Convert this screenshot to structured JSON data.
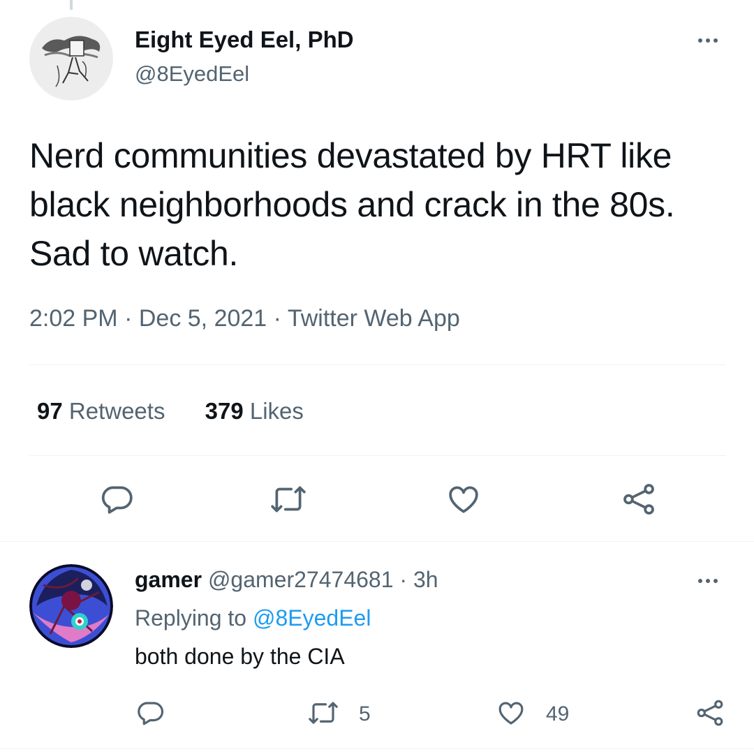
{
  "tweet": {
    "author_name": "Eight Eyed Eel, PhD",
    "author_handle": "@8EyedEel",
    "text": "Nerd communities devastated by HRT like black neighborhoods and crack in the 80s. Sad to watch.",
    "time": "2:02 PM",
    "date": "Dec 5, 2021",
    "source": "Twitter Web App",
    "separator": "·",
    "retweets_count": "97",
    "retweets_label": "Retweets",
    "likes_count": "379",
    "likes_label": "Likes"
  },
  "reply": {
    "author_name": "gamer",
    "author_handle": "@gamer27474681",
    "separator": "·",
    "age": "3h",
    "replying_label": "Replying to",
    "replying_handle": "@8EyedEel",
    "text": "both done by the CIA",
    "retweet_count": "5",
    "like_count": "49"
  },
  "icons": {
    "reply": "speech-bubble-icon",
    "retweet": "retweet-arrows-icon",
    "like": "heart-icon",
    "share": "share-nodes-icon",
    "more": "more-dots-icon"
  },
  "colors": {
    "text": "#0f1419",
    "muted": "#536471",
    "link": "#1d9bf0",
    "divider": "#eff3f4"
  }
}
